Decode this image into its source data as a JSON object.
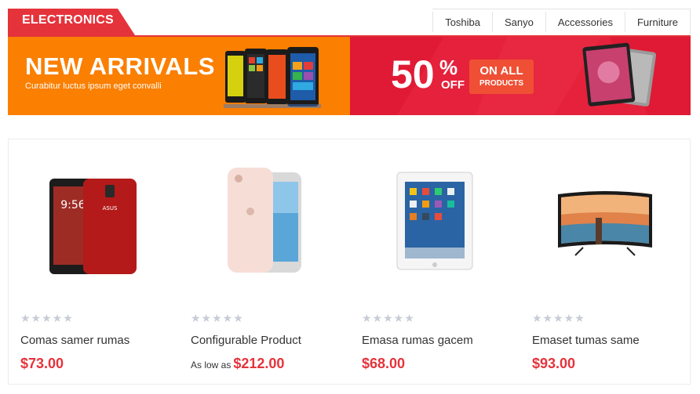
{
  "header": {
    "category": "ELECTRONICS",
    "nav": [
      "Toshiba",
      "Sanyo",
      "Accessories",
      "Furniture"
    ]
  },
  "banner": {
    "title": "NEW ARRIVALS",
    "subtitle": "Curabitur luctus ipsum eget convalli",
    "discount": "50",
    "percent_sign": "%",
    "off": "OFF",
    "on_all_line1": "ON ALL",
    "on_all_line2": "PRODUCTS",
    "colors": {
      "left": "#fb7f00",
      "right": "#e6213b"
    }
  },
  "products": [
    {
      "name": "Comas samer rumas",
      "price": "$73.00",
      "prefix": "",
      "image": "red-android-phone"
    },
    {
      "name": "Configurable Product",
      "price": "$212.00",
      "prefix": "As low as",
      "image": "rose-gold-iphone-pair"
    },
    {
      "name": "Emasa rumas gacem",
      "price": "$68.00",
      "prefix": "",
      "image": "white-tablet"
    },
    {
      "name": "Emaset tumas same",
      "price": "$93.00",
      "prefix": "",
      "image": "curved-tv"
    }
  ],
  "rating": "★★★★★",
  "accent": "#e5333b"
}
